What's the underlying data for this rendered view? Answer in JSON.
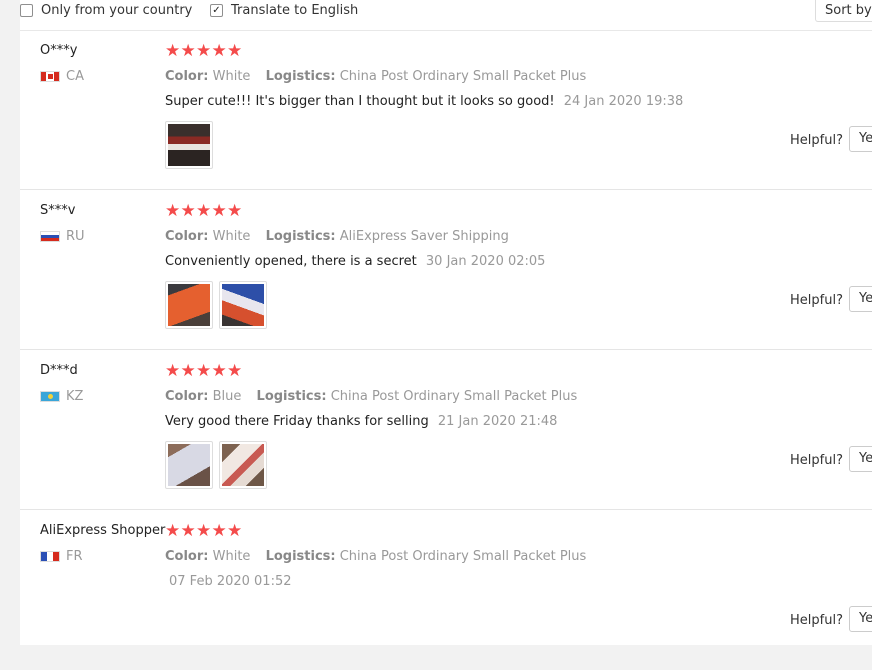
{
  "filters": {
    "only_country_label": "Only from your country",
    "translate_label": "Translate to English",
    "sort_label": "Sort by"
  },
  "labels": {
    "color": "Color:",
    "logistics": "Logistics:",
    "helpful": "Helpful?",
    "yes": "Ye"
  },
  "reviews": [
    {
      "user": "O***y",
      "country": "CA",
      "color": "White",
      "logistics": "China Post Ordinary Small Packet Plus",
      "text": "Super cute!!! It's bigger than I thought but it looks so good!",
      "date": "24 Jan 2020 19:38"
    },
    {
      "user": "S***v",
      "country": "RU",
      "color": "White",
      "logistics": "AliExpress Saver Shipping",
      "text": "Conveniently opened, there is a secret",
      "date": "30 Jan 2020 02:05"
    },
    {
      "user": "D***d",
      "country": "KZ",
      "color": "Blue",
      "logistics": "China Post Ordinary Small Packet Plus",
      "text": "Very good there Friday thanks for selling",
      "date": "21 Jan 2020 21:48"
    },
    {
      "user": "AliExpress Shopper",
      "country": "FR",
      "color": "White",
      "logistics": "China Post Ordinary Small Packet Plus",
      "text": "",
      "date": "07 Feb 2020 01:52"
    }
  ]
}
